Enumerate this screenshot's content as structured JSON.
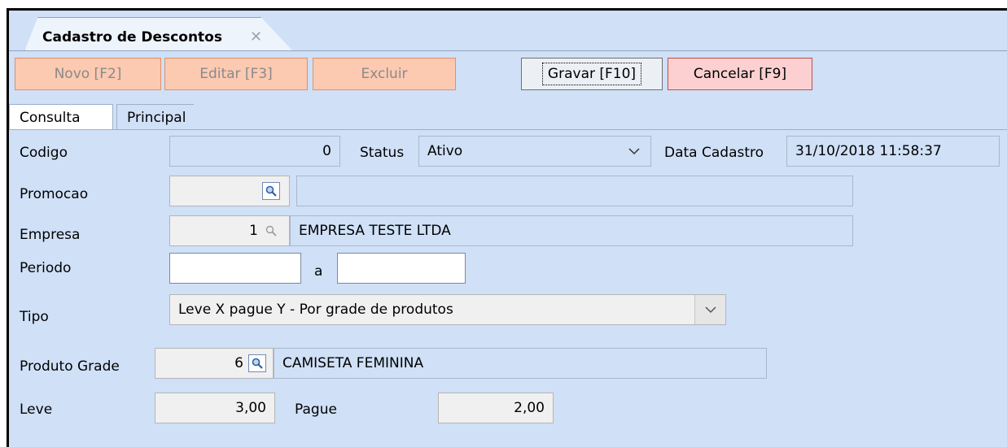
{
  "window": {
    "tab_title": "Cadastro de Descontos",
    "tab_close": "✕"
  },
  "toolbar": {
    "novo": "Novo [F2]",
    "editar": "Editar [F3]",
    "excluir": "Excluir",
    "gravar": "Gravar [F10]",
    "cancelar": "Cancelar [F9]"
  },
  "tabs": {
    "consulta": "Consulta",
    "principal": "Principal"
  },
  "form": {
    "codigo_label": "Codigo",
    "codigo_value": "0",
    "status_label": "Status",
    "status_value": "Ativo",
    "data_cadastro_label": "Data Cadastro",
    "data_cadastro_value": "31/10/2018 11:58:37",
    "promocao_label": "Promocao",
    "promocao_code": "",
    "promocao_desc": "",
    "empresa_label": "Empresa",
    "empresa_code": "1",
    "empresa_desc": "EMPRESA TESTE LTDA",
    "periodo_label": "Periodo",
    "periodo_from": "",
    "periodo_sep": "a",
    "periodo_to": "",
    "tipo_label": "Tipo",
    "tipo_value": "Leve X pague Y - Por grade de produtos",
    "produto_grade_label": "Produto Grade",
    "produto_grade_code": "6",
    "produto_grade_desc": "CAMISETA FEMININA",
    "leve_label": "Leve",
    "leve_value": "3,00",
    "pague_label": "Pague",
    "pague_value": "2,00"
  },
  "icons": {
    "lookup": "magnifier-icon",
    "dropdown": "chevron-down-icon",
    "close": "close-icon"
  },
  "colors": {
    "panel": "#cfe0f7",
    "disabled_button": "#fcc9b1",
    "cancel_button": "#fcd0d0"
  }
}
